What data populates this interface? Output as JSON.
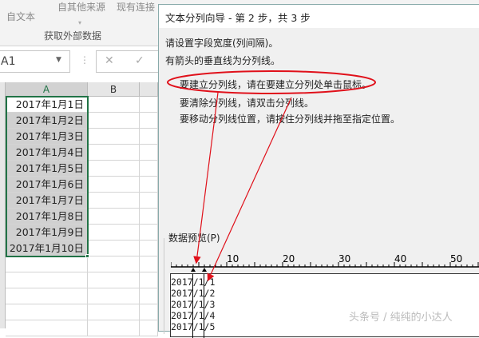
{
  "ribbon": {
    "from_text": "自文本",
    "from_other": "自其他来源",
    "existing": "现有连接",
    "group_label": "获取外部数据"
  },
  "formula_bar": {
    "name_box": "A1",
    "cancel": "✕",
    "enter": "✓"
  },
  "sheet": {
    "columns": [
      "A",
      "B"
    ],
    "cells": [
      "2017年1月1日",
      "2017年1月2日",
      "2017年1月3日",
      "2017年1月4日",
      "2017年1月5日",
      "2017年1月6日",
      "2017年1月7日",
      "2017年1月8日",
      "2017年1月9日",
      "2017年1月10日"
    ]
  },
  "dialog": {
    "title": "文本分列向导 - 第 2 步，共 3 步",
    "line1": "请设置字段宽度(列间隔)。",
    "line2": "有箭头的垂直线为分列线。",
    "hint1": "要建立分列线，请在要建立分列处单击鼠标。",
    "hint2": "要清除分列线，请双击分列线。",
    "hint3": "要移动分列线位置，请按住分列线并拖至指定位置。",
    "preview_label": "数据预览(P)",
    "ruler_labels": [
      "10",
      "20",
      "30",
      "40",
      "50"
    ],
    "break_positions": [
      4,
      6
    ],
    "preview_lines": [
      "2017/1/1",
      "2017/1/2",
      "2017/1/3",
      "2017/1/4",
      "2017/1/5"
    ]
  },
  "watermark": "头条号 / 纯纯的小达人",
  "colors": {
    "annotation": "#e0101a",
    "selection": "#217346"
  }
}
